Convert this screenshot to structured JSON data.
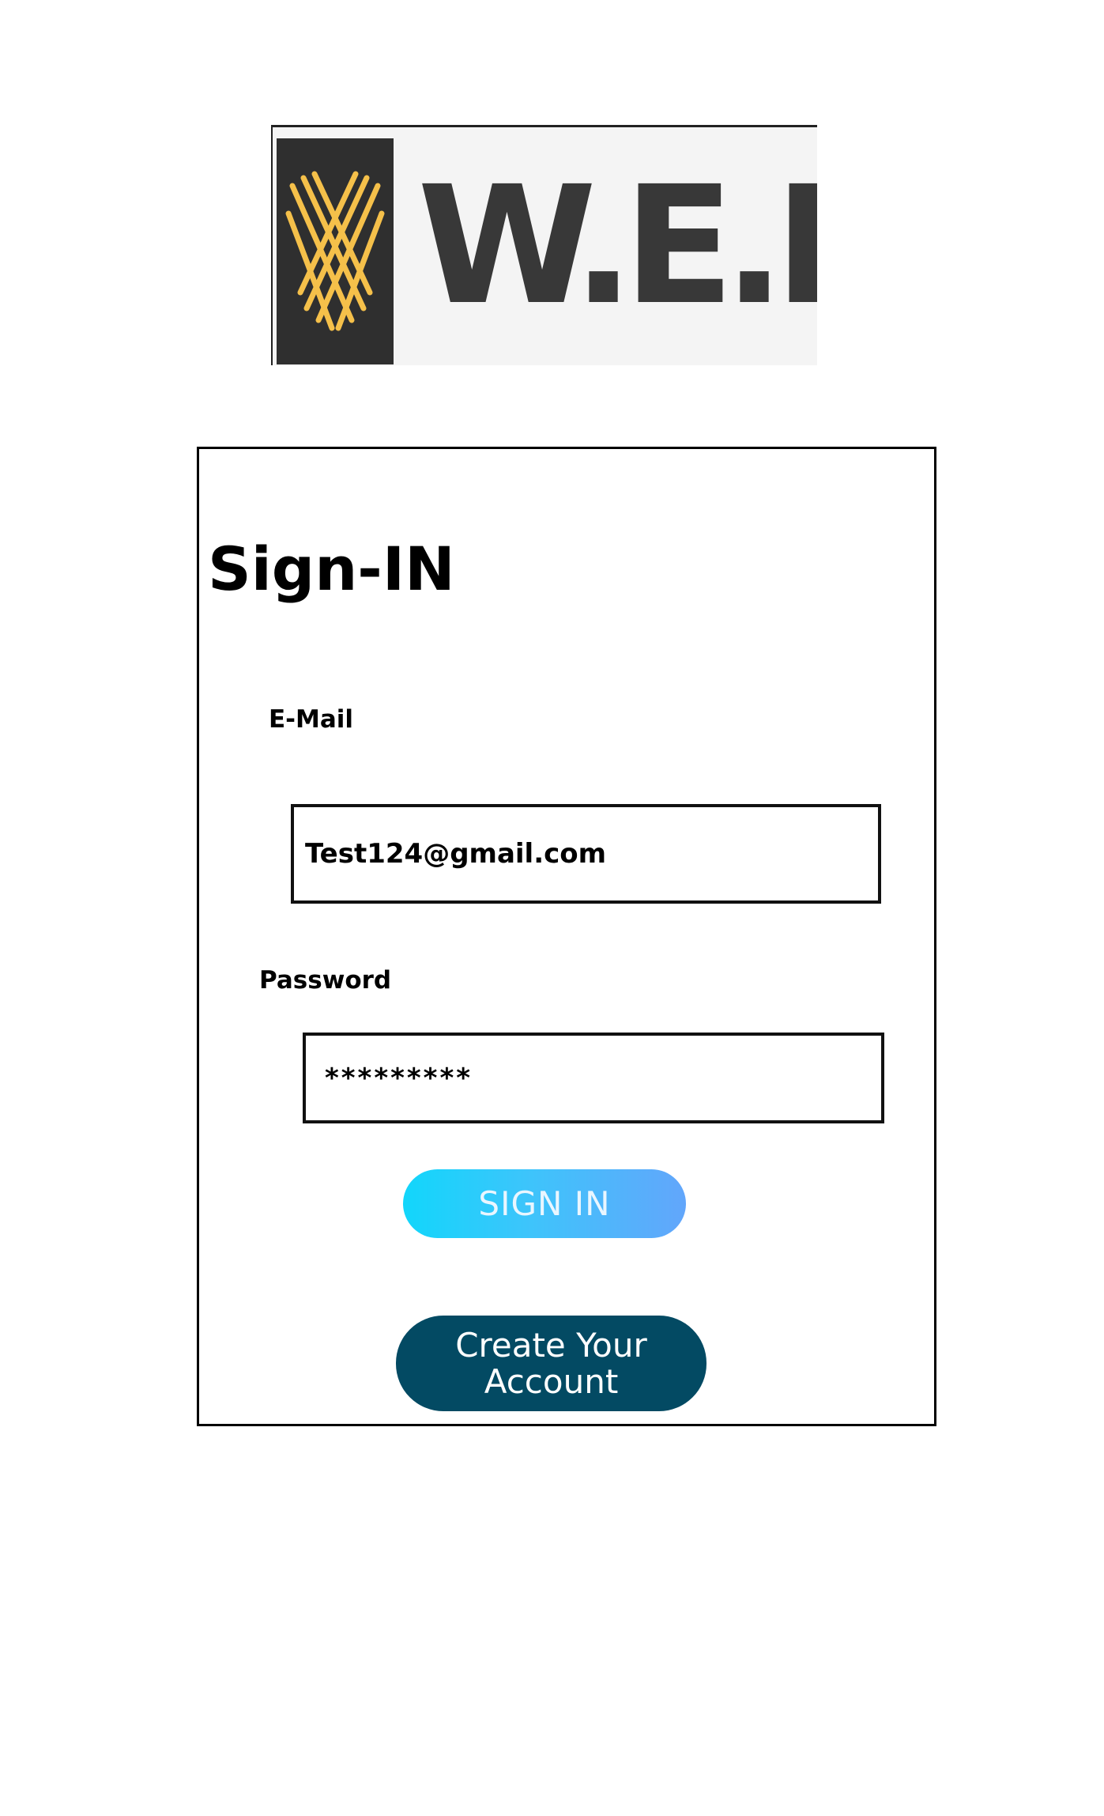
{
  "logo": {
    "text": "W.E.F.U",
    "mark_color": "#f5c04a",
    "mark_background": "#2f2f2f",
    "text_color": "#383838"
  },
  "form": {
    "title": "Sign-IN",
    "email_label": "E-Mail",
    "email_value": "Test124@gmail.com",
    "password_label": "Password",
    "password_value": "*********",
    "signin_button": "SIGN IN",
    "create_account_button": "Create Your Account"
  },
  "colors": {
    "signin_gradient_start": "#12d6fb",
    "signin_gradient_end": "#62a6fb",
    "create_account_bg": "#034a63"
  }
}
